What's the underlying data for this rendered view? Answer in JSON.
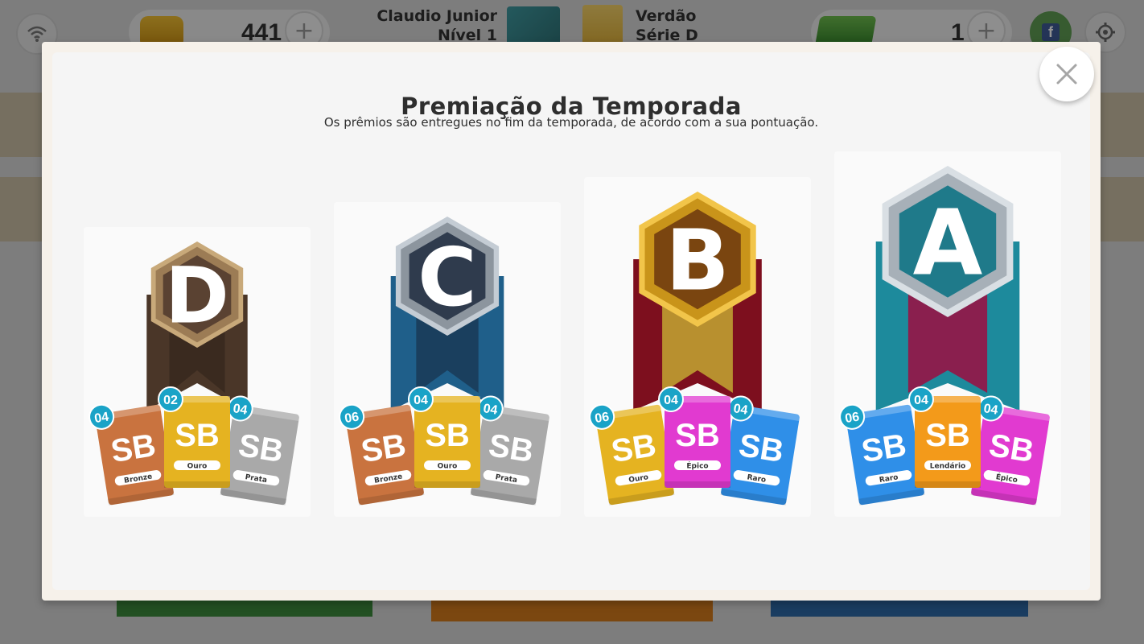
{
  "topbar": {
    "coins": "441",
    "player": {
      "name": "Claudio Junior",
      "level": "Nível 1"
    },
    "club": {
      "name": "Verdão",
      "division": "Série D"
    },
    "cash": "1",
    "plus_symbol": "+"
  },
  "modal": {
    "title": "Premiação da Temporada",
    "subtitle": "Os prêmios são entregues no fim da temporada, de acordo com a sua pontuação.",
    "close_symbol": "×"
  },
  "tiers": [
    {
      "letter": "D",
      "packs": [
        {
          "count": "04",
          "label": "Bronze",
          "color": "#c9733f"
        },
        {
          "count": "02",
          "label": "Ouro",
          "color": "#e5b321"
        },
        {
          "count": "04",
          "label": "Prata",
          "color": "#a9a9a9"
        }
      ]
    },
    {
      "letter": "C",
      "packs": [
        {
          "count": "06",
          "label": "Bronze",
          "color": "#c9733f"
        },
        {
          "count": "04",
          "label": "Ouro",
          "color": "#e5b321"
        },
        {
          "count": "04",
          "label": "Prata",
          "color": "#a9a9a9"
        }
      ]
    },
    {
      "letter": "B",
      "packs": [
        {
          "count": "06",
          "label": "Ouro",
          "color": "#e5b321"
        },
        {
          "count": "04",
          "label": "Épico",
          "color": "#e13ad0"
        },
        {
          "count": "04",
          "label": "Raro",
          "color": "#2f8fe8"
        }
      ]
    },
    {
      "letter": "A",
      "packs": [
        {
          "count": "06",
          "label": "Raro",
          "color": "#2f8fe8"
        },
        {
          "count": "04",
          "label": "Lendário",
          "color": "#f39a1a"
        },
        {
          "count": "04",
          "label": "Épico",
          "color": "#e13ad0"
        }
      ]
    }
  ],
  "pack_logo": "SB",
  "colors": {
    "count_badge": "#1aa3c7",
    "tier_d": "#5a4232",
    "tier_c": "#2f3b4d",
    "tier_b": "#7a4510",
    "tier_a": "#1f7a8a"
  }
}
